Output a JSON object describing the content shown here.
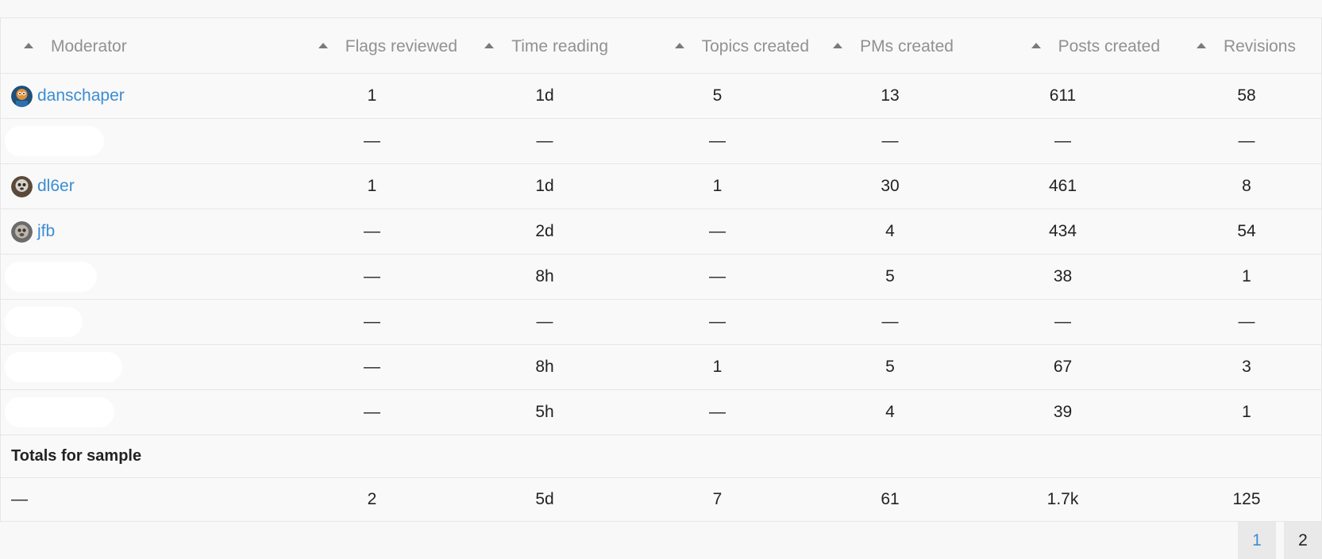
{
  "table": {
    "columns": [
      {
        "label": "Moderator"
      },
      {
        "label": "Flags reviewed"
      },
      {
        "label": "Time reading"
      },
      {
        "label": "Topics created"
      },
      {
        "label": "PMs created"
      },
      {
        "label": "Posts created"
      },
      {
        "label": "Revisions"
      }
    ],
    "rows": [
      {
        "username": "danschaper",
        "values": [
          "1",
          "1d",
          "5",
          "13",
          "611",
          "58"
        ]
      },
      {
        "username": "",
        "values": [
          "—",
          "—",
          "—",
          "—",
          "—",
          "—"
        ]
      },
      {
        "username": "dl6er",
        "values": [
          "1",
          "1d",
          "1",
          "30",
          "461",
          "8"
        ]
      },
      {
        "username": "jfb",
        "values": [
          "—",
          "2d",
          "—",
          "4",
          "434",
          "54"
        ]
      },
      {
        "username": "",
        "values": [
          "—",
          "8h",
          "—",
          "5",
          "38",
          "1"
        ]
      },
      {
        "username": "",
        "values": [
          "—",
          "—",
          "—",
          "—",
          "—",
          "—"
        ]
      },
      {
        "username": "",
        "values": [
          "—",
          "8h",
          "1",
          "5",
          "67",
          "3"
        ]
      },
      {
        "username": "",
        "values": [
          "—",
          "5h",
          "—",
          "4",
          "39",
          "1"
        ]
      }
    ],
    "totals_label": "Totals for sample",
    "totals": [
      "—",
      "2",
      "5d",
      "7",
      "61",
      "1.7k",
      "125"
    ]
  },
  "pagination": {
    "pages": [
      "1",
      "2"
    ],
    "current": "1"
  },
  "colors": {
    "link": "#3b8dd2",
    "header_text": "#919191",
    "border": "#e6e6e6"
  }
}
